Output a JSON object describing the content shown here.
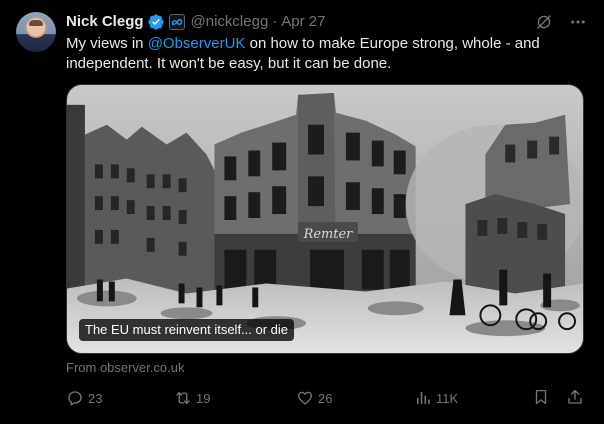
{
  "author": {
    "name": "Nick Clegg",
    "handle": "@nickclegg",
    "separator": "·",
    "date": "Apr 27"
  },
  "tweet": {
    "text_before": "My views in ",
    "mention": "@ObserverUK",
    "text_after": " on how to make Europe strong, whole - and independent. It won't be easy, but it can be done."
  },
  "card": {
    "caption": "The EU must reinvent itself... or die",
    "storefront_sign": "Remter",
    "source": "From observer.co.uk"
  },
  "actions": {
    "replies": "23",
    "reposts": "19",
    "likes": "26",
    "views": "11K"
  },
  "colors": {
    "background": "#000000",
    "text": "#e7e9ea",
    "muted": "#71767b",
    "accent": "#1d9bf0",
    "verified": "#1d9bf0"
  },
  "icons": [
    "verified-badge-icon",
    "meta-affiliate-icon",
    "grok-icon",
    "more-icon",
    "reply-icon",
    "repost-icon",
    "like-icon",
    "views-icon",
    "bookmark-icon",
    "share-icon"
  ]
}
